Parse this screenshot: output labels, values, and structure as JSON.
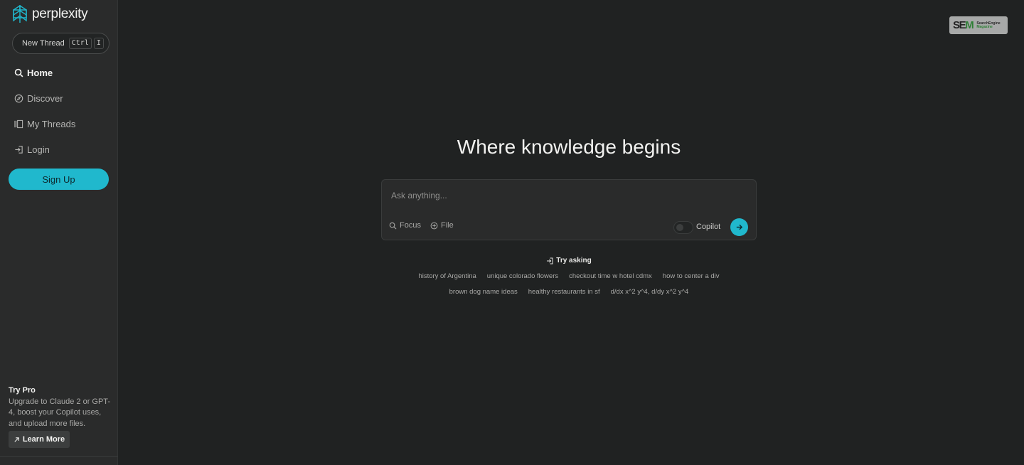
{
  "app": {
    "logo_text": "perplexity",
    "accent_color": "#20b8cd",
    "background_color": "#202222",
    "sidebar_color": "#2a2b2b"
  },
  "sidebar": {
    "new_thread": {
      "label": "New Thread",
      "shortcut_keys": [
        "Ctrl",
        "I"
      ]
    },
    "nav": [
      {
        "label": "Home",
        "icon": "search-icon",
        "active": true
      },
      {
        "label": "Discover",
        "icon": "compass-icon",
        "active": false
      },
      {
        "label": "My Threads",
        "icon": "library-icon",
        "active": false
      },
      {
        "label": "Login",
        "icon": "login-icon",
        "active": false
      }
    ],
    "signup_label": "Sign Up",
    "promo": {
      "title": "Try Pro",
      "description": "Upgrade to Claude 2 or GPT-4, boost your Copilot uses, and upload more files.",
      "button_label": "Learn More",
      "button_icon": "arrow-up-right-icon"
    }
  },
  "main": {
    "headline": "Where knowledge begins",
    "search": {
      "placeholder": "Ask anything...",
      "focus_label": "Focus",
      "file_label": "File",
      "copilot_label": "Copilot",
      "copilot_enabled": false,
      "submit_icon": "arrow-right-icon"
    },
    "try_asking": {
      "label": "Try asking",
      "suggestions_row1": [
        "history of Argentina",
        "unique colorado flowers",
        "checkout time w hotel cdmx",
        "how to center a div"
      ],
      "suggestions_row2": [
        "brown dog name ideas",
        "healthy restaurants in sf",
        "d/dx x^2 y^4, d/dy x^2 y^4"
      ]
    }
  },
  "watermark": {
    "letters_se": "SE",
    "letters_m": "M",
    "line1": "SearchEngine",
    "line2": "Magazine"
  }
}
